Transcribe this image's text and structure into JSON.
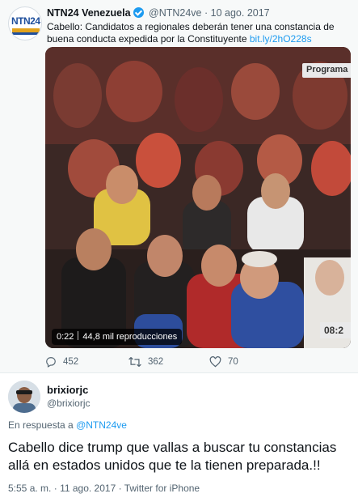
{
  "quoted_tweet": {
    "author_name": "NTN24 Venezuela",
    "author_handle": "@NTN24ve",
    "dot": "·",
    "date": "10 ago. 2017",
    "text": "Cabello: Candidatos a regionales deberán tener una constancia de buena conducta expedida por la Constituyente",
    "link": "bit.ly/2hO228s",
    "avatar_logo_text": "NTN24",
    "video": {
      "time": "0:22",
      "views": "44,8 mil reproducciones",
      "overlay_label": "Programa",
      "overlay_counter": "08:2"
    },
    "actions": {
      "replies": "452",
      "retweets": "362",
      "likes": "70"
    }
  },
  "reply": {
    "author_name": "brixiorjc",
    "author_handle": "@brixiorjc",
    "in_reply_prefix": "En respuesta a",
    "in_reply_mention": "@NTN24ve",
    "text": "Cabello dice trump que vallas a buscar tu constancias allá en estados unidos que te la tienen preparada.!!",
    "time": "5:55 a. m.",
    "dot": "·",
    "date": "11 ago. 2017",
    "source": "Twitter for iPhone"
  },
  "colors": {
    "link": "#1d9bf0",
    "muted": "#536471",
    "quoted_bg": "#f7f9f9",
    "video_bg": "#3a2a26"
  },
  "icons": [
    "verified-badge-icon",
    "reply-icon",
    "retweet-icon",
    "like-icon"
  ]
}
